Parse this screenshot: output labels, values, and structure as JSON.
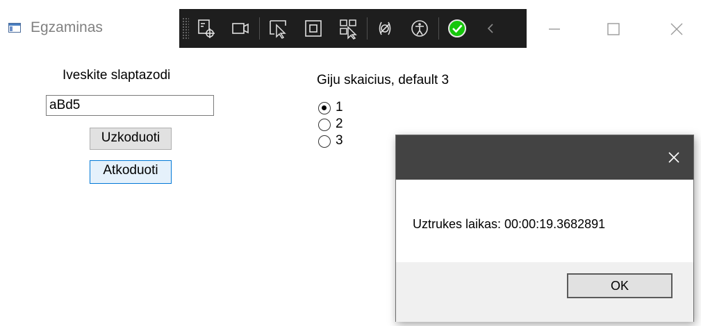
{
  "window": {
    "title": "Egzaminas",
    "icon": "app-window-icon",
    "controls": [
      "minimize-icon",
      "maximize-icon",
      "close-icon"
    ]
  },
  "debug_toolbar": {
    "background": "#1e1e1e",
    "items": [
      "live-visual-tree-icon",
      "video-camera-icon",
      "select-element-icon",
      "display-layout-adorners-icon",
      "track-focus-icon",
      "binding-failures-icon",
      "accessibility-icon",
      "hot-reload-check-icon",
      "collapse-chevron-icon"
    ]
  },
  "password": {
    "label": "Iveskite slaptazodi",
    "value": "aBd5",
    "encode_button": "Uzkoduoti",
    "decode_button": "Atkoduoti"
  },
  "threads": {
    "label": "Giju skaicius, default 3",
    "options": [
      "1",
      "2",
      "3"
    ],
    "selected": "1"
  },
  "message_box": {
    "text": "Uztrukes laikas: 00:00:19.3682891",
    "ok_button": "OK",
    "close_icon": "close-icon"
  },
  "colors": {
    "accent": "#0078d7",
    "decode_button_bg": "#e5f1fb",
    "dialog_titlebar": "#434343",
    "dialog_footer": "#f0f0f0",
    "hot_reload_ok": "#16c60c"
  }
}
